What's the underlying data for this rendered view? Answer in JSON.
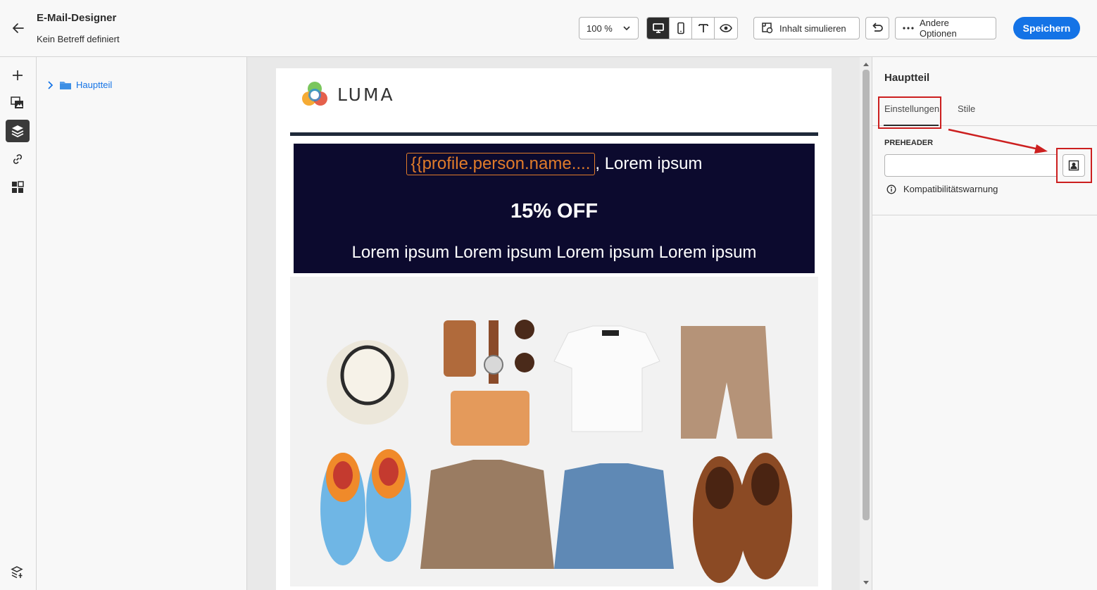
{
  "header": {
    "title": "E-Mail-Designer",
    "subtitle": "Kein Betreff definiert",
    "zoom": "100 %",
    "simulate_label": "Inhalt simulieren",
    "more_options_label": "Andere Optionen",
    "save_label": "Speichern"
  },
  "tree": {
    "root_label": "Hauptteil"
  },
  "email": {
    "logo_text": "LUMA",
    "token": "{{profile.person.name....",
    "greeting_suffix": ", Lorem ipsum",
    "offer": "15% OFF",
    "tagline": "Lorem ipsum Lorem ipsum Lorem ipsum Lorem ipsum"
  },
  "props": {
    "title": "Hauptteil",
    "tab_settings": "Einstellungen",
    "tab_styles": "Stile",
    "preheader_label": "PREHEADER",
    "preheader_value": "",
    "compat_warning": "Kompatibilitätswarnung"
  },
  "colors": {
    "accent": "#1473e6",
    "banner_bg": "#0c0a2e",
    "token": "#e07b2a",
    "highlight": "#cc1f1f"
  }
}
